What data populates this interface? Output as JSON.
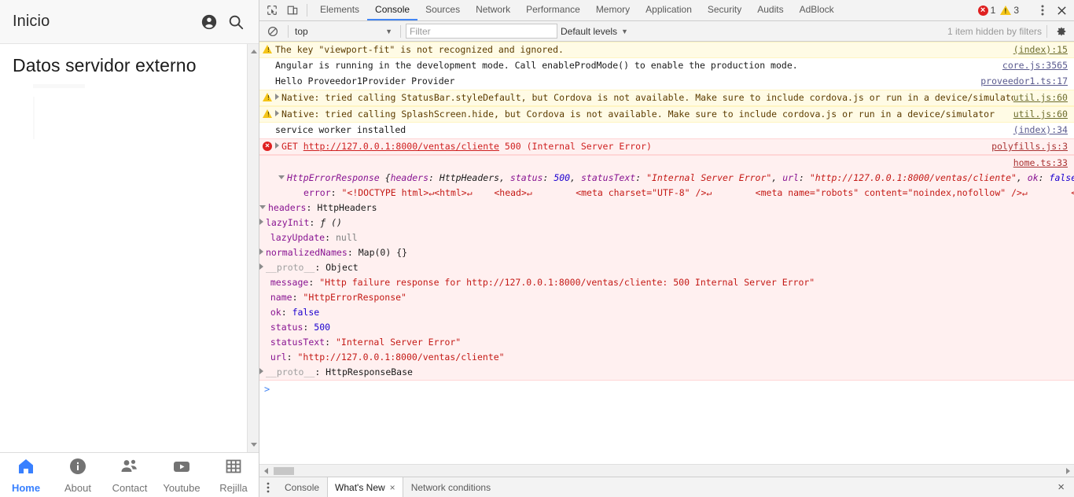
{
  "app": {
    "header": {
      "title": "Inicio",
      "account_icon": "account-circle-icon",
      "search_icon": "search-icon"
    },
    "content": {
      "heading": "Datos servidor externo"
    },
    "tabs": [
      {
        "label": "Home",
        "icon": "home-icon",
        "active": true
      },
      {
        "label": "About",
        "icon": "info-icon",
        "active": false
      },
      {
        "label": "Contact",
        "icon": "people-icon",
        "active": false
      },
      {
        "label": "Youtube",
        "icon": "youtube-icon",
        "active": false
      },
      {
        "label": "Rejilla",
        "icon": "grid-icon",
        "active": false
      }
    ],
    "accent_color": "#3880ff"
  },
  "devtools": {
    "toolbar": {
      "inspect_icon": "inspect-element-icon",
      "device_icon": "toggle-device-toolbar-icon",
      "tabs": [
        {
          "label": "Elements",
          "active": false
        },
        {
          "label": "Console",
          "active": true
        },
        {
          "label": "Sources",
          "active": false
        },
        {
          "label": "Network",
          "active": false
        },
        {
          "label": "Performance",
          "active": false
        },
        {
          "label": "Memory",
          "active": false
        },
        {
          "label": "Application",
          "active": false
        },
        {
          "label": "Security",
          "active": false
        },
        {
          "label": "Audits",
          "active": false
        },
        {
          "label": "AdBlock",
          "active": false
        }
      ],
      "error_count": "1",
      "warning_count": "3",
      "more_icon": "more-vertical-icon",
      "close_icon": "close-icon"
    },
    "console_toolbar": {
      "clear_icon": "clear-console-icon",
      "context": "top",
      "filter_placeholder": "Filter",
      "filter_value": "",
      "levels": "Default levels",
      "hidden_note": "1 item hidden by filters",
      "settings_icon": "gear-icon"
    },
    "messages": [
      {
        "level": "warn",
        "icon": "warning-icon",
        "text": "The key \"viewport-fit\" is not recognized and ignored.",
        "source": "(index):15"
      },
      {
        "level": "log",
        "text": "Angular is running in the development mode. Call enableProdMode() to enable the production mode.",
        "source": "core.js:3565"
      },
      {
        "level": "log",
        "text": "Hello Proveedor1Provider Provider",
        "source": "proveedor1.ts:17"
      },
      {
        "level": "warn",
        "icon": "warning-icon",
        "expandable": true,
        "text": "Native: tried calling StatusBar.styleDefault, but Cordova is not available. Make sure to include cordova.js or run in a device/simulator",
        "source": "util.js:60"
      },
      {
        "level": "warn",
        "icon": "warning-icon",
        "expandable": true,
        "text": "Native: tried calling SplashScreen.hide, but Cordova is not available. Make sure to include cordova.js or run in a device/simulator",
        "source": "util.js:60"
      },
      {
        "level": "log",
        "text": "service worker installed",
        "source": "(index):34"
      }
    ],
    "network_error": {
      "level": "error",
      "icon": "error-icon",
      "method": "GET",
      "url": "http://127.0.0.1:8000/ventas/cliente",
      "status": "500",
      "status_phrase": "(Internal Server Error)",
      "source": "polyfills.js:3"
    },
    "error_object": {
      "source": "home.ts:33",
      "header": {
        "class_name": "HttpErrorResponse",
        "preview_parts": [
          {
            "key": "headers",
            "value": "HttpHeaders",
            "type": "obj"
          },
          {
            "key": "status",
            "value": "500",
            "type": "num"
          },
          {
            "key": "statusText",
            "value": "\"Internal Server Error\"",
            "type": "str"
          },
          {
            "key": "url",
            "value": "\"http://127.0.0.1:8000/ventas/cliente\"",
            "type": "str"
          },
          {
            "key": "ok",
            "value": "false",
            "type": "bool"
          }
        ],
        "ellipsis": "…",
        "info_badge": "i"
      },
      "error_line": {
        "key": "error",
        "value": "\"<!DOCTYPE html>↵<html>↵    <head>↵        <meta charset=\"UTF-8\" />↵        <meta name=\"robots\" content=\"noindex,nofollow\" />↵        <style>"
      },
      "rows": [
        {
          "indent": 1,
          "expander": "open",
          "key": "headers",
          "sep": ": ",
          "value": "HttpHeaders",
          "vtype": "obj",
          "dim": false
        },
        {
          "indent": 2,
          "expander": "closed",
          "key": "lazyInit",
          "sep": ": ",
          "value": "ƒ ()",
          "vtype": "fn",
          "dim": false
        },
        {
          "indent": 2,
          "expander": "none",
          "key": "lazyUpdate",
          "sep": ": ",
          "value": "null",
          "vtype": "null",
          "dim": false
        },
        {
          "indent": 2,
          "expander": "closed",
          "key": "normalizedNames",
          "sep": ": ",
          "value": "Map(0) {}",
          "vtype": "obj",
          "dim": false
        },
        {
          "indent": 2,
          "expander": "closed",
          "key": "__proto__",
          "sep": ": ",
          "value": "Object",
          "vtype": "obj",
          "dim": true
        },
        {
          "indent": 2,
          "expander": "none",
          "key": "message",
          "sep": ": ",
          "value": "\"Http failure response for http://127.0.0.1:8000/ventas/cliente: 500 Internal Server Error\"",
          "vtype": "str",
          "dim": false
        },
        {
          "indent": 2,
          "expander": "none",
          "key": "name",
          "sep": ": ",
          "value": "\"HttpErrorResponse\"",
          "vtype": "str",
          "dim": false
        },
        {
          "indent": 2,
          "expander": "none",
          "key": "ok",
          "sep": ": ",
          "value": "false",
          "vtype": "bool",
          "dim": false
        },
        {
          "indent": 2,
          "expander": "none",
          "key": "status",
          "sep": ": ",
          "value": "500",
          "vtype": "num",
          "dim": false
        },
        {
          "indent": 2,
          "expander": "none",
          "key": "statusText",
          "sep": ": ",
          "value": "\"Internal Server Error\"",
          "vtype": "str",
          "dim": false
        },
        {
          "indent": 2,
          "expander": "none",
          "key": "url",
          "sep": ": ",
          "value": "\"http://127.0.0.1:8000/ventas/cliente\"",
          "vtype": "str",
          "dim": false
        },
        {
          "indent": 1,
          "expander": "closed",
          "key": "__proto__",
          "sep": ": ",
          "value": "HttpResponseBase",
          "vtype": "obj",
          "dim": true
        }
      ]
    },
    "prompt": ">",
    "drawer": {
      "menu_icon": "more-vertical-icon",
      "tabs": [
        {
          "label": "Console",
          "active": false,
          "closable": false
        },
        {
          "label": "What's New",
          "active": true,
          "closable": true
        },
        {
          "label": "Network conditions",
          "active": false,
          "closable": false
        }
      ],
      "close_icon": "close-icon"
    }
  }
}
